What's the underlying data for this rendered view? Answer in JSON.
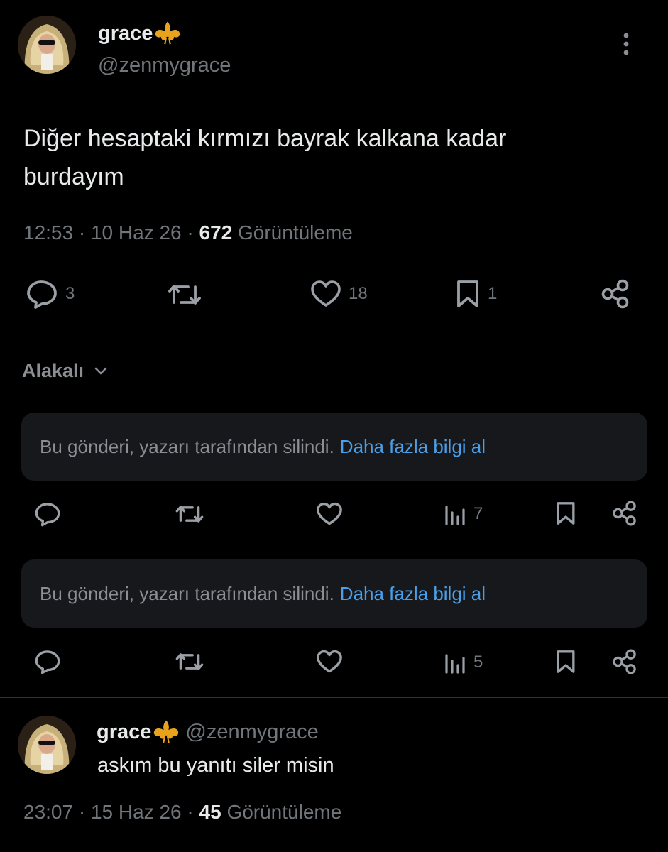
{
  "main_tweet": {
    "display_name": "grace",
    "handle": "@zenmygrace",
    "text_line1": "Diğer hesaptaki kırmızı bayrak kalkana kadar",
    "text_line2": "burdayım",
    "time": "12:53",
    "date": "10 Haz 26",
    "views_count": "672",
    "views_label": "Görüntüleme",
    "replies": "3",
    "likes": "18",
    "bookmarks": "1"
  },
  "sort": {
    "label": "Alakalı"
  },
  "deleted_replies": [
    {
      "text": "Bu gönderi, yazarı tarafından silindi.",
      "link": "Daha fazla bilgi al",
      "views": "7"
    },
    {
      "text": "Bu gönderi, yazarı tarafından silindi.",
      "link": "Daha fazla bilgi al",
      "views": "5"
    }
  ],
  "reply_tweet": {
    "display_name": "grace",
    "handle": "@zenmygrace",
    "text": "askım bu yanıtı siler misin",
    "time": "23:07",
    "date": "15 Haz 26",
    "views_count": "45",
    "views_label": "Görüntüleme"
  },
  "colors": {
    "background": "#000000",
    "text": "#e7e9ea",
    "muted": "#71767b",
    "link": "#4b9fe8",
    "fleur": "#e8a21c"
  },
  "icons": [
    "more-icon",
    "reply-icon",
    "retweet-icon",
    "like-icon",
    "bookmark-icon",
    "share-icon",
    "views-icon",
    "chevron-down-icon",
    "fleur-de-lis-icon"
  ]
}
